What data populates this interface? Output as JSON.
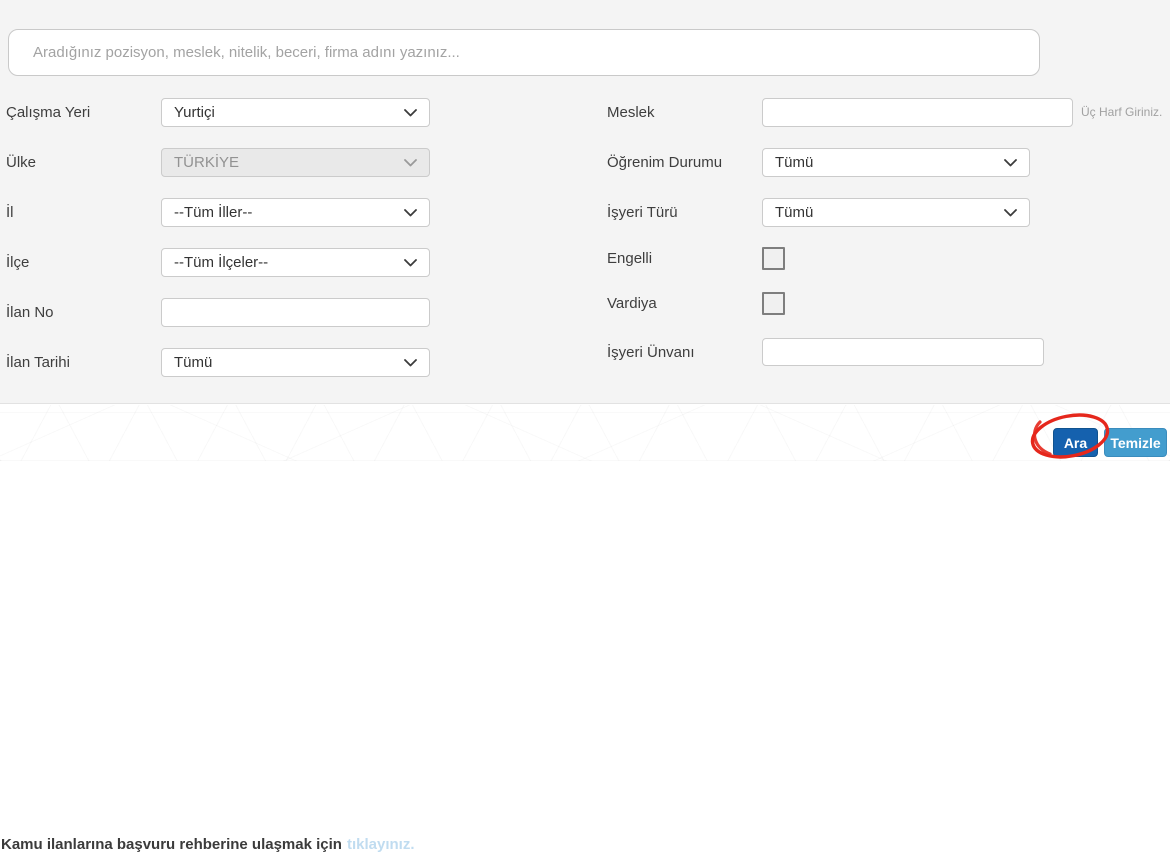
{
  "search": {
    "placeholder": "Aradığınız pozisyon, meslek, nitelik, beceri, firma adını yazınız..."
  },
  "form": {
    "left": [
      {
        "label": "Çalışma Yeri",
        "type": "select",
        "value": "Yurtiçi"
      },
      {
        "label": "Ülke",
        "type": "select",
        "value": "TÜRKİYE",
        "disabled": true
      },
      {
        "label": "İl",
        "type": "select",
        "value": "--Tüm İller--"
      },
      {
        "label": "İlçe",
        "type": "select",
        "value": "--Tüm İlçeler--"
      },
      {
        "label": "İlan No",
        "type": "text",
        "value": ""
      },
      {
        "label": "İlan Tarihi",
        "type": "select",
        "value": "Tümü"
      }
    ],
    "right": [
      {
        "label": "Meslek",
        "type": "text",
        "value": "",
        "hint": "Üç Harf Giriniz."
      },
      {
        "label": "Öğrenim Durumu",
        "type": "select",
        "value": "Tümü"
      },
      {
        "label": "İşyeri Türü",
        "type": "select",
        "value": "Tümü"
      },
      {
        "label": "Engelli",
        "type": "checkbox",
        "checked": false
      },
      {
        "label": "Vardiya",
        "type": "checkbox",
        "checked": false
      },
      {
        "label": "İşyeri Ünvanı",
        "type": "text",
        "value": ""
      }
    ]
  },
  "footer": {
    "text": "Kamu ilanlarına başvuru rehberine ulaşmak için",
    "link_label": "tıklayınız.",
    "ara_label": "Ara",
    "temizle_label": "Temizle"
  },
  "colors": {
    "form_background": "#f4f4f4",
    "ara_button": "#1561ae",
    "temizle_button": "#439dce",
    "link": "#c0dcf0",
    "annotation_red": "#e5271c"
  }
}
